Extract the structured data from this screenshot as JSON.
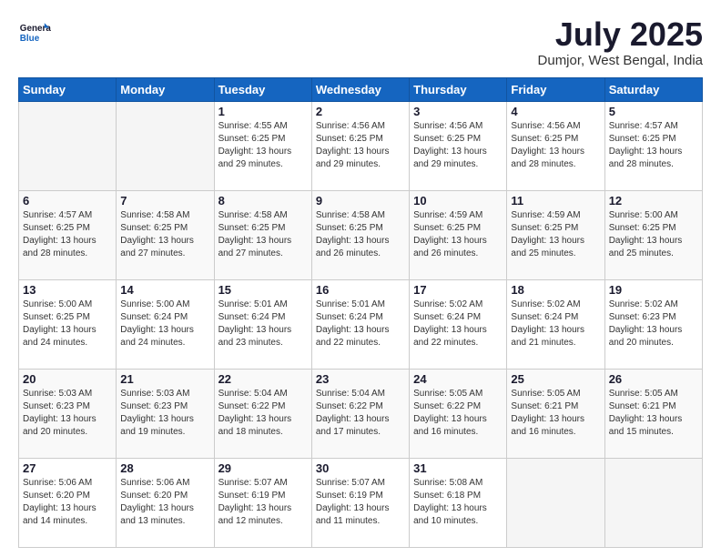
{
  "logo": {
    "line1": "General",
    "line2": "Blue"
  },
  "title": "July 2025",
  "subtitle": "Dumjor, West Bengal, India",
  "weekdays": [
    "Sunday",
    "Monday",
    "Tuesday",
    "Wednesday",
    "Thursday",
    "Friday",
    "Saturday"
  ],
  "weeks": [
    [
      {
        "day": "",
        "sunrise": "",
        "sunset": "",
        "daylight": ""
      },
      {
        "day": "",
        "sunrise": "",
        "sunset": "",
        "daylight": ""
      },
      {
        "day": "1",
        "sunrise": "Sunrise: 4:55 AM",
        "sunset": "Sunset: 6:25 PM",
        "daylight": "Daylight: 13 hours and 29 minutes."
      },
      {
        "day": "2",
        "sunrise": "Sunrise: 4:56 AM",
        "sunset": "Sunset: 6:25 PM",
        "daylight": "Daylight: 13 hours and 29 minutes."
      },
      {
        "day": "3",
        "sunrise": "Sunrise: 4:56 AM",
        "sunset": "Sunset: 6:25 PM",
        "daylight": "Daylight: 13 hours and 29 minutes."
      },
      {
        "day": "4",
        "sunrise": "Sunrise: 4:56 AM",
        "sunset": "Sunset: 6:25 PM",
        "daylight": "Daylight: 13 hours and 28 minutes."
      },
      {
        "day": "5",
        "sunrise": "Sunrise: 4:57 AM",
        "sunset": "Sunset: 6:25 PM",
        "daylight": "Daylight: 13 hours and 28 minutes."
      }
    ],
    [
      {
        "day": "6",
        "sunrise": "Sunrise: 4:57 AM",
        "sunset": "Sunset: 6:25 PM",
        "daylight": "Daylight: 13 hours and 28 minutes."
      },
      {
        "day": "7",
        "sunrise": "Sunrise: 4:58 AM",
        "sunset": "Sunset: 6:25 PM",
        "daylight": "Daylight: 13 hours and 27 minutes."
      },
      {
        "day": "8",
        "sunrise": "Sunrise: 4:58 AM",
        "sunset": "Sunset: 6:25 PM",
        "daylight": "Daylight: 13 hours and 27 minutes."
      },
      {
        "day": "9",
        "sunrise": "Sunrise: 4:58 AM",
        "sunset": "Sunset: 6:25 PM",
        "daylight": "Daylight: 13 hours and 26 minutes."
      },
      {
        "day": "10",
        "sunrise": "Sunrise: 4:59 AM",
        "sunset": "Sunset: 6:25 PM",
        "daylight": "Daylight: 13 hours and 26 minutes."
      },
      {
        "day": "11",
        "sunrise": "Sunrise: 4:59 AM",
        "sunset": "Sunset: 6:25 PM",
        "daylight": "Daylight: 13 hours and 25 minutes."
      },
      {
        "day": "12",
        "sunrise": "Sunrise: 5:00 AM",
        "sunset": "Sunset: 6:25 PM",
        "daylight": "Daylight: 13 hours and 25 minutes."
      }
    ],
    [
      {
        "day": "13",
        "sunrise": "Sunrise: 5:00 AM",
        "sunset": "Sunset: 6:25 PM",
        "daylight": "Daylight: 13 hours and 24 minutes."
      },
      {
        "day": "14",
        "sunrise": "Sunrise: 5:00 AM",
        "sunset": "Sunset: 6:24 PM",
        "daylight": "Daylight: 13 hours and 24 minutes."
      },
      {
        "day": "15",
        "sunrise": "Sunrise: 5:01 AM",
        "sunset": "Sunset: 6:24 PM",
        "daylight": "Daylight: 13 hours and 23 minutes."
      },
      {
        "day": "16",
        "sunrise": "Sunrise: 5:01 AM",
        "sunset": "Sunset: 6:24 PM",
        "daylight": "Daylight: 13 hours and 22 minutes."
      },
      {
        "day": "17",
        "sunrise": "Sunrise: 5:02 AM",
        "sunset": "Sunset: 6:24 PM",
        "daylight": "Daylight: 13 hours and 22 minutes."
      },
      {
        "day": "18",
        "sunrise": "Sunrise: 5:02 AM",
        "sunset": "Sunset: 6:24 PM",
        "daylight": "Daylight: 13 hours and 21 minutes."
      },
      {
        "day": "19",
        "sunrise": "Sunrise: 5:02 AM",
        "sunset": "Sunset: 6:23 PM",
        "daylight": "Daylight: 13 hours and 20 minutes."
      }
    ],
    [
      {
        "day": "20",
        "sunrise": "Sunrise: 5:03 AM",
        "sunset": "Sunset: 6:23 PM",
        "daylight": "Daylight: 13 hours and 20 minutes."
      },
      {
        "day": "21",
        "sunrise": "Sunrise: 5:03 AM",
        "sunset": "Sunset: 6:23 PM",
        "daylight": "Daylight: 13 hours and 19 minutes."
      },
      {
        "day": "22",
        "sunrise": "Sunrise: 5:04 AM",
        "sunset": "Sunset: 6:22 PM",
        "daylight": "Daylight: 13 hours and 18 minutes."
      },
      {
        "day": "23",
        "sunrise": "Sunrise: 5:04 AM",
        "sunset": "Sunset: 6:22 PM",
        "daylight": "Daylight: 13 hours and 17 minutes."
      },
      {
        "day": "24",
        "sunrise": "Sunrise: 5:05 AM",
        "sunset": "Sunset: 6:22 PM",
        "daylight": "Daylight: 13 hours and 16 minutes."
      },
      {
        "day": "25",
        "sunrise": "Sunrise: 5:05 AM",
        "sunset": "Sunset: 6:21 PM",
        "daylight": "Daylight: 13 hours and 16 minutes."
      },
      {
        "day": "26",
        "sunrise": "Sunrise: 5:05 AM",
        "sunset": "Sunset: 6:21 PM",
        "daylight": "Daylight: 13 hours and 15 minutes."
      }
    ],
    [
      {
        "day": "27",
        "sunrise": "Sunrise: 5:06 AM",
        "sunset": "Sunset: 6:20 PM",
        "daylight": "Daylight: 13 hours and 14 minutes."
      },
      {
        "day": "28",
        "sunrise": "Sunrise: 5:06 AM",
        "sunset": "Sunset: 6:20 PM",
        "daylight": "Daylight: 13 hours and 13 minutes."
      },
      {
        "day": "29",
        "sunrise": "Sunrise: 5:07 AM",
        "sunset": "Sunset: 6:19 PM",
        "daylight": "Daylight: 13 hours and 12 minutes."
      },
      {
        "day": "30",
        "sunrise": "Sunrise: 5:07 AM",
        "sunset": "Sunset: 6:19 PM",
        "daylight": "Daylight: 13 hours and 11 minutes."
      },
      {
        "day": "31",
        "sunrise": "Sunrise: 5:08 AM",
        "sunset": "Sunset: 6:18 PM",
        "daylight": "Daylight: 13 hours and 10 minutes."
      },
      {
        "day": "",
        "sunrise": "",
        "sunset": "",
        "daylight": ""
      },
      {
        "day": "",
        "sunrise": "",
        "sunset": "",
        "daylight": ""
      }
    ]
  ]
}
